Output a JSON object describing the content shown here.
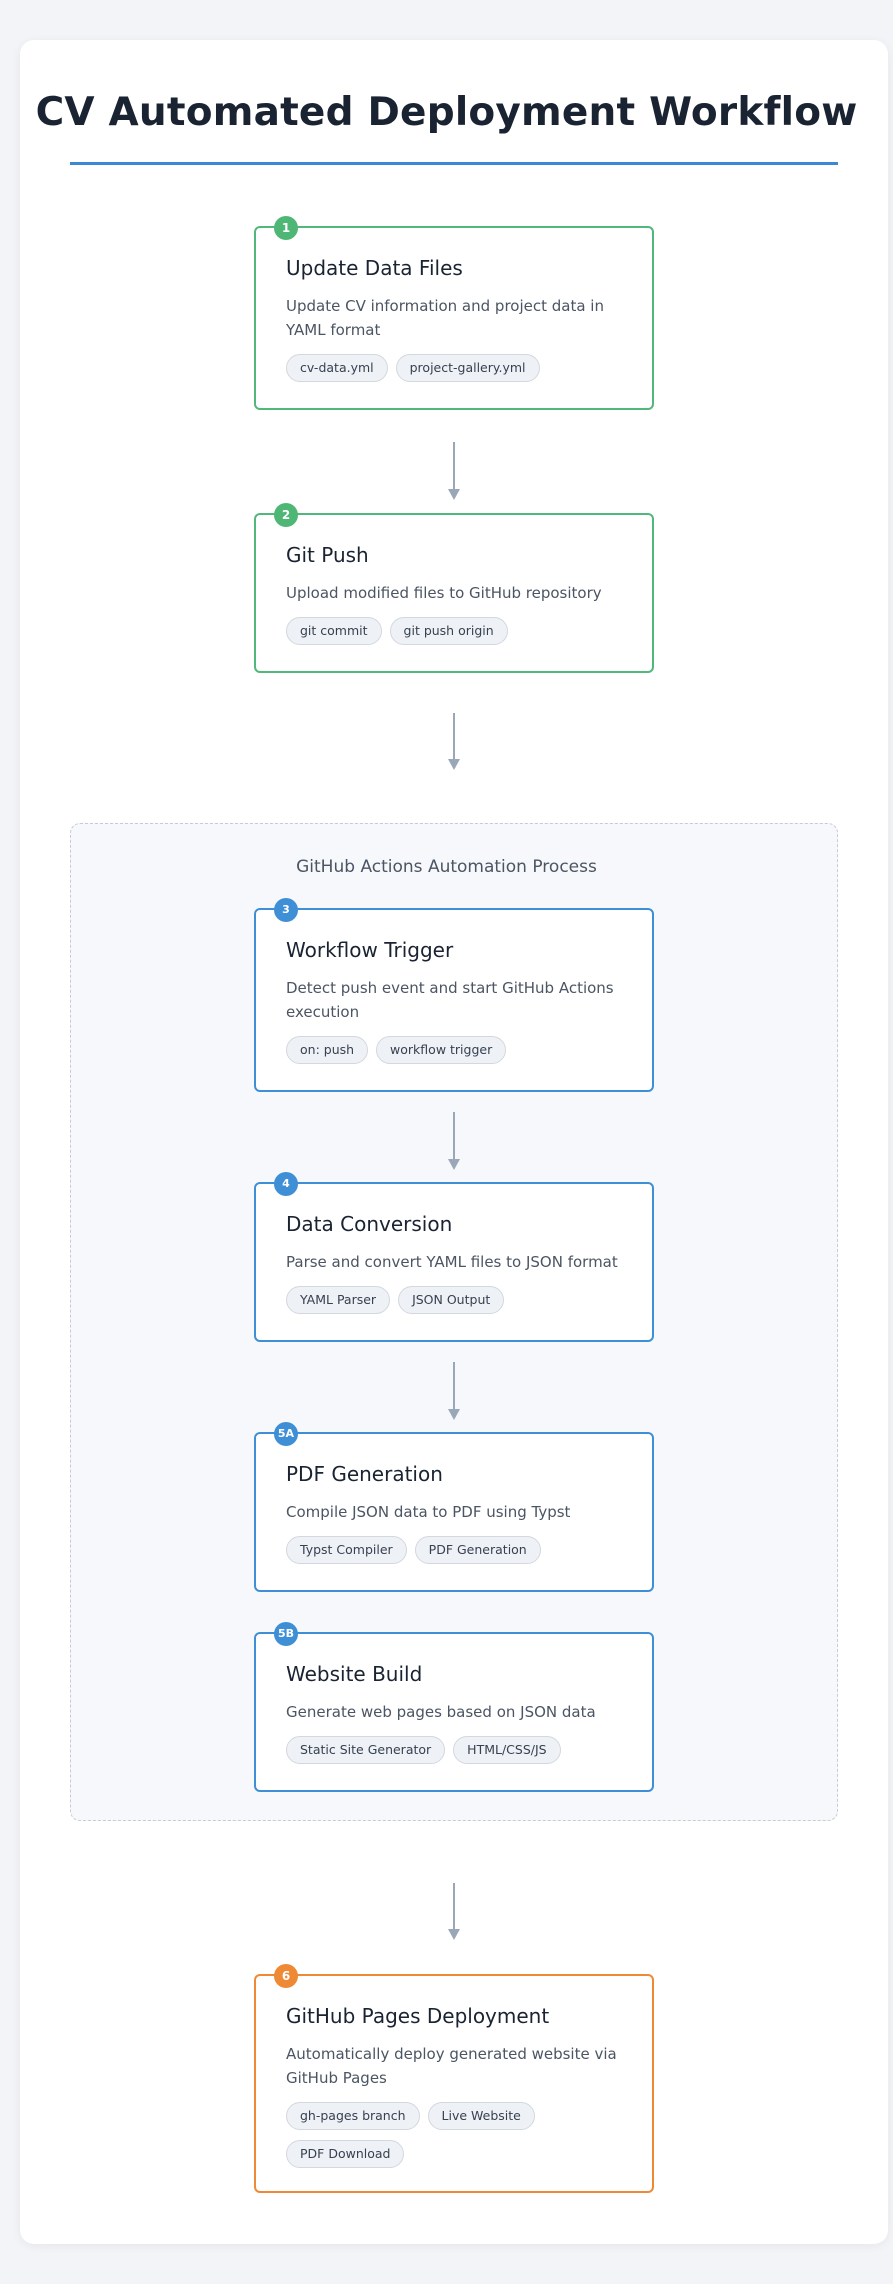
{
  "title": "CV Automated Deployment Workflow",
  "group_label": "GitHub Actions Automation Process",
  "steps": [
    {
      "badge": "1",
      "title": "Update Data Files",
      "desc": "Update CV information and project data in YAML format",
      "tags": [
        "cv-data.yml",
        "project-gallery.yml"
      ],
      "color": "#52b77a"
    },
    {
      "badge": "2",
      "title": "Git Push",
      "desc": "Upload modified files to GitHub repository",
      "tags": [
        "git commit",
        "git push origin"
      ],
      "color": "#52b77a"
    },
    {
      "badge": "3",
      "title": "Workflow Trigger",
      "desc": "Detect push event and start GitHub Actions execution",
      "tags": [
        "on: push",
        "workflow trigger"
      ],
      "color": "#3f8fd6"
    },
    {
      "badge": "4",
      "title": "Data Conversion",
      "desc": "Parse and convert YAML files to JSON format",
      "tags": [
        "YAML Parser",
        "JSON Output"
      ],
      "color": "#3f8fd6"
    },
    {
      "badge": "5A",
      "title": "PDF Generation",
      "desc": "Compile JSON data to PDF using Typst",
      "tags": [
        "Typst Compiler",
        "PDF Generation"
      ],
      "color": "#3f8fd6"
    },
    {
      "badge": "5B",
      "title": "Website Build",
      "desc": "Generate web pages based on JSON data",
      "tags": [
        "Static Site Generator",
        "HTML/CSS/JS"
      ],
      "color": "#3f8fd6"
    },
    {
      "badge": "6",
      "title": "GitHub Pages Deployment",
      "desc": "Automatically deploy generated website via GitHub Pages",
      "tags": [
        "gh-pages branch",
        "Live Website",
        "PDF Download"
      ],
      "color": "#ee8a35"
    }
  ]
}
